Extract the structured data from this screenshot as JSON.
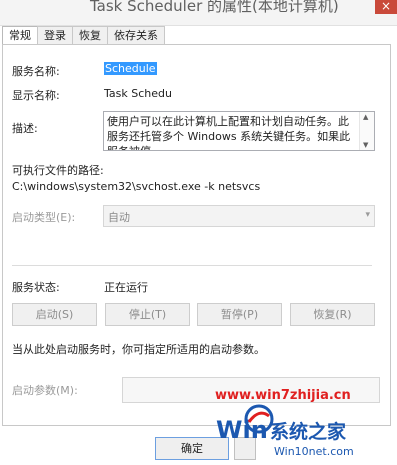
{
  "window": {
    "title": "Task Scheduler 的属性(本地计算机)",
    "close_glyph": "×"
  },
  "tabs": [
    {
      "label": "常规",
      "active": true
    },
    {
      "label": "登录",
      "active": false
    },
    {
      "label": "恢复",
      "active": false
    },
    {
      "label": "依存关系",
      "active": false
    }
  ],
  "general": {
    "service_name_label": "服务名称:",
    "service_name_value": "Schedule",
    "display_name_label": "显示名称:",
    "display_name_value": "Task Schedu",
    "description_label": "描述:",
    "description_text": "使用户可以在此计算机上配置和计划自动任务。此服务还托管多个 Windows 系统关键任务。如果此服务被停",
    "exe_path_label": "可执行文件的路径:",
    "exe_path_value": "C:\\windows\\system32\\svchost.exe -k netsvcs",
    "startup_type_label": "启动类型(E):",
    "startup_type_value": "自动",
    "service_status_label": "服务状态:",
    "service_status_value": "正在运行",
    "buttons": {
      "start": "启动(S)",
      "stop": "停止(T)",
      "pause": "暂停(P)",
      "resume": "恢复(R)"
    },
    "hint": "当从此处启动服务时，你可指定所适用的启动参数。",
    "start_params_label": "启动参数(M):",
    "start_params_value": ""
  },
  "footer": {
    "ok": "确定"
  },
  "watermark": {
    "url_top": "www.win7zhijia.cn",
    "brand": "系统之家",
    "url_bottom": "Win10net.com",
    "logo_text": "Win7"
  },
  "colors": {
    "selection": "#3399ff",
    "watermark_red": "#e02020",
    "watermark_blue": "#1c58b0"
  }
}
